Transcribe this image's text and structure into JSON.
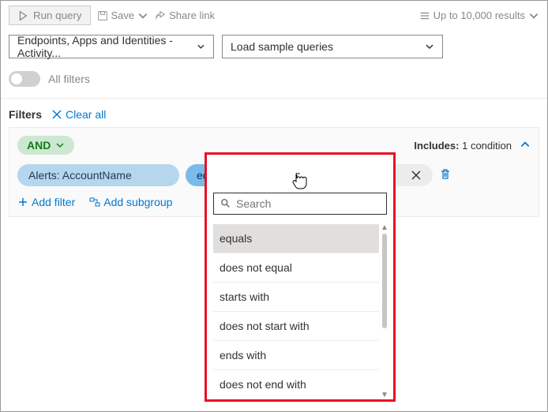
{
  "toolbar": {
    "run": "Run query",
    "save": "Save",
    "share": "Share link",
    "results": "Up to 10,000 results"
  },
  "selectors": {
    "scope": "Endpoints, Apps and Identities - Activity...",
    "sample": "Load sample queries"
  },
  "allFilters": "All filters",
  "filtersLabel": "Filters",
  "clearAll": "Clear all",
  "condition": {
    "operator": "AND",
    "includesLabel": "Includes:",
    "includesCount": "1 condition",
    "field": "Alerts: AccountName",
    "op": "equals",
    "searchPlaceholder": "Search"
  },
  "addFilter": "Add filter",
  "addSubgroup": "Add subgroup",
  "dropdown": {
    "searchPlaceholder": "Search",
    "items": [
      "equals",
      "does not equal",
      "starts with",
      "does not start with",
      "ends with",
      "does not end with"
    ]
  }
}
